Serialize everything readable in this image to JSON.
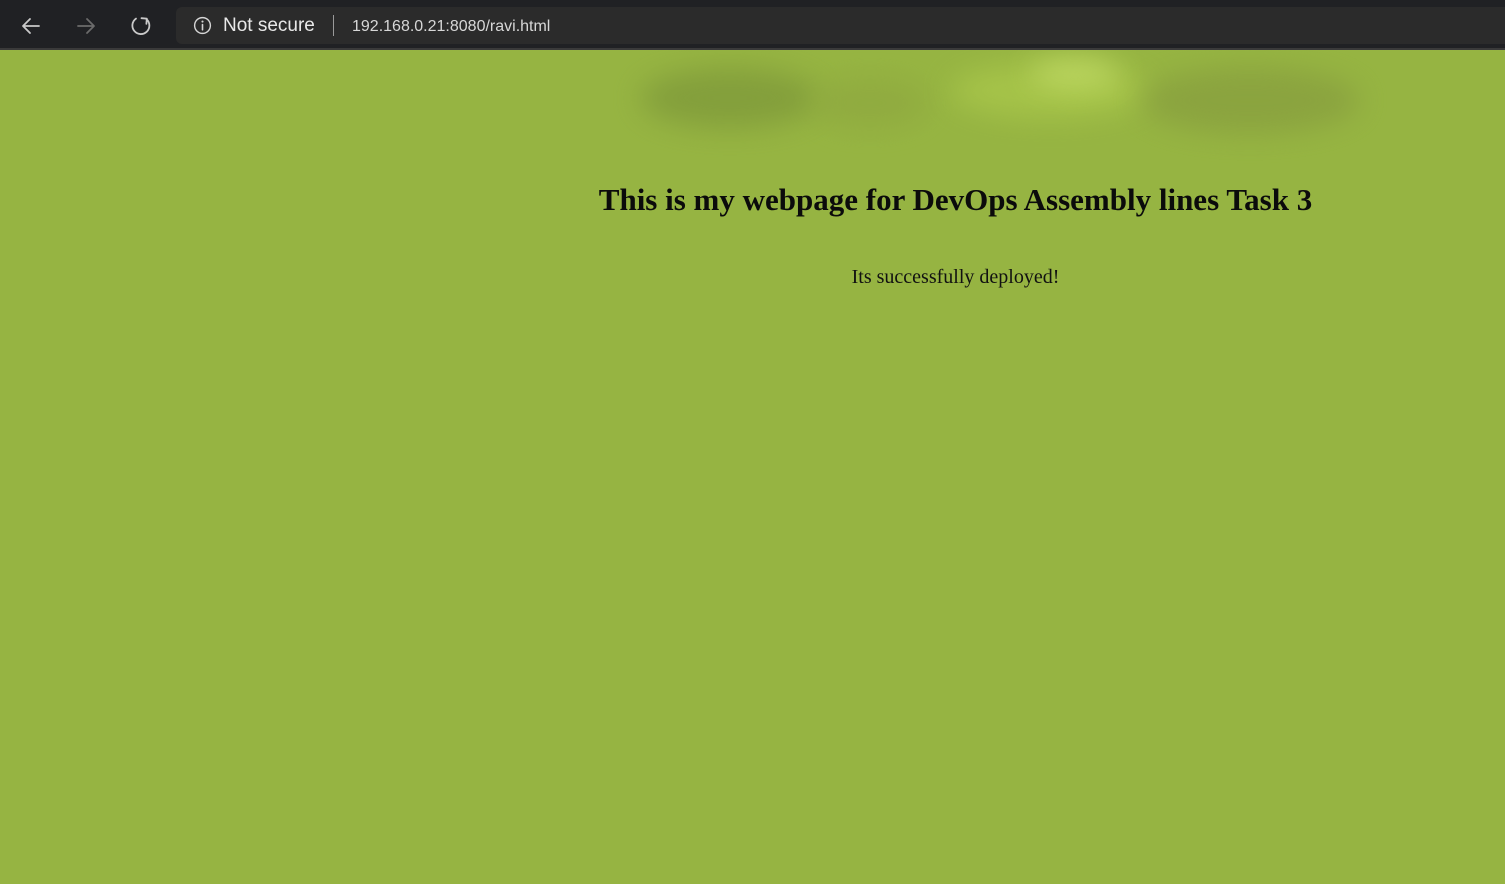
{
  "browser": {
    "nav": {
      "back_icon": "arrow-left-icon",
      "forward_icon": "arrow-right-icon",
      "reload_icon": "reload-icon"
    },
    "address_bar": {
      "security_icon": "info-icon",
      "security_label": "Not secure",
      "url": "192.168.0.21:8080/ravi.html"
    }
  },
  "page": {
    "background_color": "#96b442",
    "heading": "This is my webpage for DevOps Assembly lines Task 3",
    "message": "Its successfully deployed!"
  }
}
